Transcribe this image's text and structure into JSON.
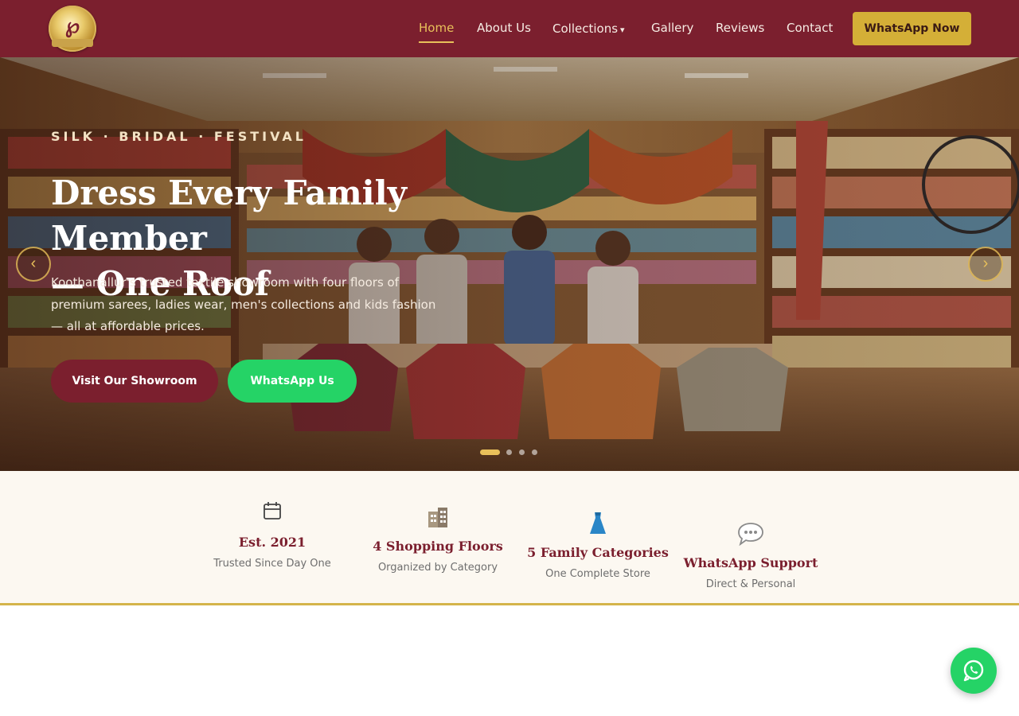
{
  "brand": {
    "colors": {
      "primary": "#7b1f2e",
      "gold": "#d4af37",
      "whatsapp": "#25d366",
      "stats_bg": "#fcf8f1"
    },
    "logo_icon": "brand-logo"
  },
  "nav": {
    "items": [
      {
        "label": "Home",
        "active": true
      },
      {
        "label": "About Us",
        "active": false
      },
      {
        "label": "Collections",
        "active": false,
        "has_dropdown": true
      },
      {
        "label": "Gallery",
        "active": false
      },
      {
        "label": "Reviews",
        "active": false
      },
      {
        "label": "Contact",
        "active": false
      }
    ],
    "cta": "WhatsApp Now"
  },
  "hero": {
    "eyebrow": "SILK · BRIDAL · FESTIVAL",
    "title_line1": "Dress Every Family Member",
    "title_line2": "— One Roof",
    "subtitle": "Koothanallur's trusted textile showroom with four floors of premium sarees, ladies wear, men's collections and kids fashion — all at affordable prices.",
    "primary_button": "Visit Our Showroom",
    "secondary_button": "WhatsApp Us",
    "prev_arrow": "‹",
    "next_arrow": "›",
    "slides_total": 4,
    "active_slide": 1
  },
  "stats": [
    {
      "icon": "calendar-icon",
      "title": "Est. 2021",
      "subtitle": "Trusted Since Day One"
    },
    {
      "icon": "building-icon",
      "title": "4 Shopping Floors",
      "subtitle": "Organized by Category"
    },
    {
      "icon": "dress-icon",
      "title": "5 Family Categories",
      "subtitle": "One Complete Store"
    },
    {
      "icon": "speech-bubble-icon",
      "title": "WhatsApp Support",
      "subtitle": "Direct & Personal"
    }
  ],
  "floating_button": {
    "icon": "whatsapp-icon"
  }
}
